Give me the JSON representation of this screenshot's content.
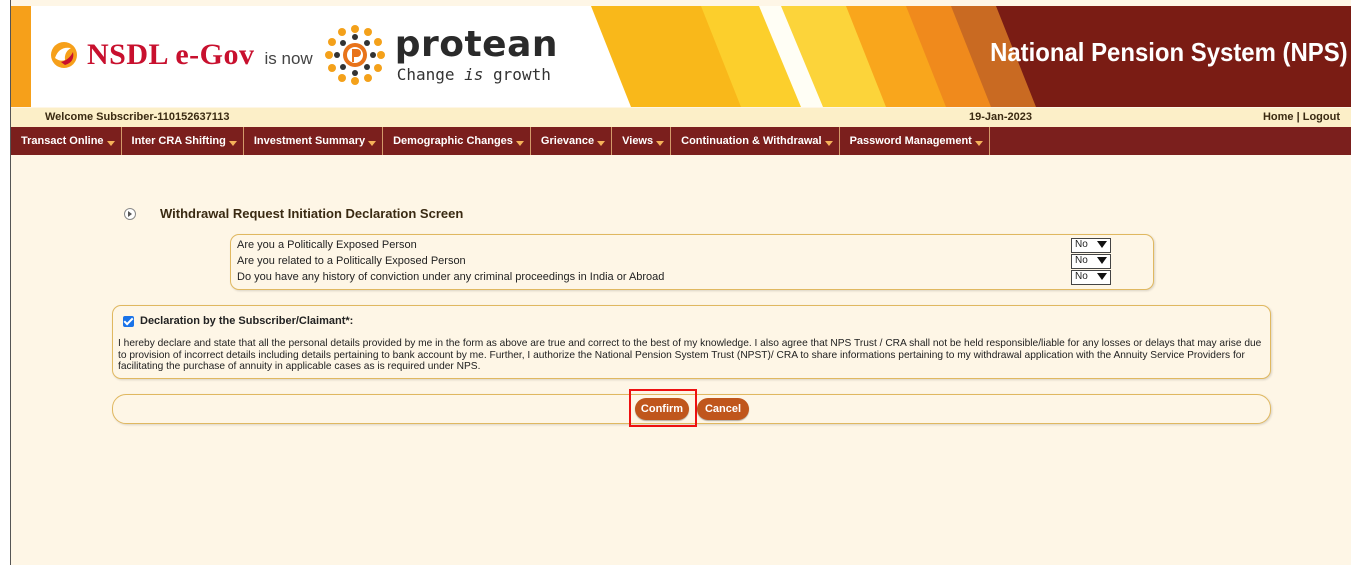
{
  "header": {
    "brand_nsdl": "NSDL e-Gov",
    "is_now": "is now",
    "brand_protean": "protean",
    "tagline_pre": "Change ",
    "tagline_is": "is",
    "tagline_post": " growth",
    "system_title": "National Pension System (NPS)"
  },
  "welcome_bar": {
    "welcome_text": "Welcome Subscriber-110152637113",
    "date": "19-Jan-2023",
    "home_label": "Home",
    "separator": " | ",
    "logout_label": "Logout"
  },
  "menu": {
    "items": [
      {
        "label": "Transact Online"
      },
      {
        "label": "Inter CRA Shifting"
      },
      {
        "label": "Investment Summary"
      },
      {
        "label": "Demographic Changes"
      },
      {
        "label": "Grievance"
      },
      {
        "label": "Views"
      },
      {
        "label": "Continuation & Withdrawal"
      },
      {
        "label": "Password Management"
      }
    ]
  },
  "screen": {
    "title": "Withdrawal Request Initiation Declaration Screen"
  },
  "questions": [
    {
      "text": "Are you a Politically Exposed Person",
      "value": "No"
    },
    {
      "text": "Are you related to a Politically Exposed Person",
      "value": "No"
    },
    {
      "text": "Do you have any history of conviction under any criminal proceedings in India or Abroad",
      "value": "No"
    }
  ],
  "declaration": {
    "checked": true,
    "title": "Declaration by the Subscriber/Claimant*:",
    "text": "I hereby declare and state that all the personal details provided by me in the form as above are true and correct to the best of my knowledge. I also agree that NPS Trust / CRA shall not be held responsible/liable for any losses or delays that may arise due to provision of incorrect details including details pertaining to bank account by me. Further, I authorize the National Pension System Trust (NPST)/ CRA to share informations pertaining to my withdrawal application with the Annuity Service Providers for facilitating the purchase of annuity in applicable cases as is required under NPS."
  },
  "actions": {
    "confirm_label": "Confirm",
    "cancel_label": "Cancel"
  },
  "colors": {
    "menu_bg": "#7b1f1d",
    "button_bg": "#c0561c",
    "panel_bg": "#fef6e6",
    "panel_border": "#e0b860",
    "highlight": "#ee1111"
  }
}
